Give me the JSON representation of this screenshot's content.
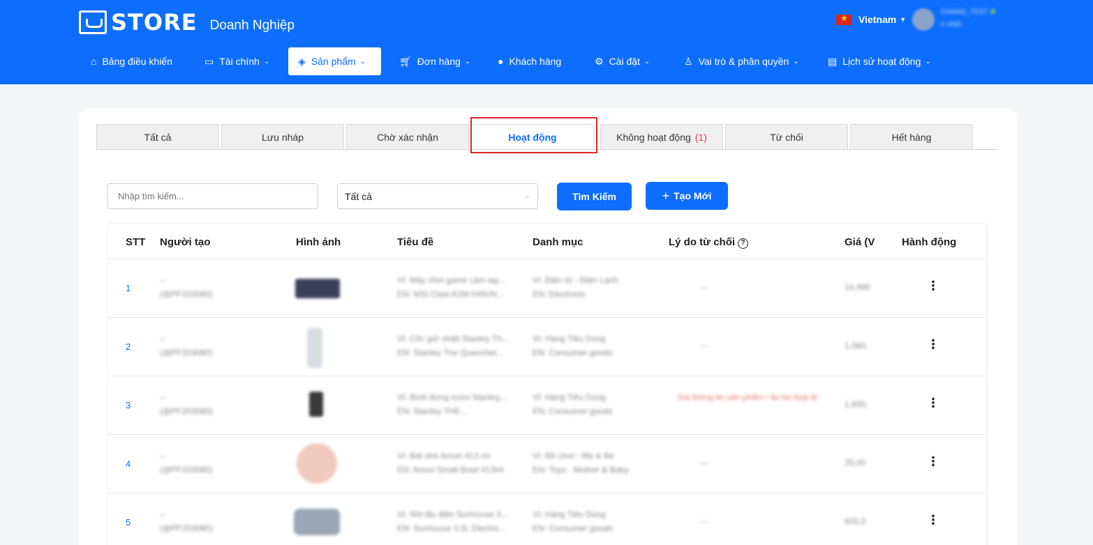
{
  "header": {
    "logo_text": "STORE",
    "subtitle": "Doanh Nghiệp",
    "language": "Vietnam",
    "user_name": "CHANG_TEST",
    "user_sub": "0 VND"
  },
  "nav": [
    {
      "label": "Bảng điều khiển",
      "icon": "home-icon"
    },
    {
      "label": "Tài chính",
      "icon": "wallet-icon"
    },
    {
      "label": "Sản phẩm",
      "icon": "layers-icon",
      "active": true
    },
    {
      "label": "Đơn hàng",
      "icon": "cart-icon"
    },
    {
      "label": "Khách hàng",
      "icon": "user-icon"
    },
    {
      "label": "Cài đặt",
      "icon": "gear-icon"
    },
    {
      "label": "Vai trò & phân quyền",
      "icon": "user-key-icon"
    },
    {
      "label": "Lịch sử hoạt động",
      "icon": "clipboard-icon"
    }
  ],
  "tabs": [
    {
      "label": "Tất cả"
    },
    {
      "label": "Lưu nháp"
    },
    {
      "label": "Chờ xác nhận"
    },
    {
      "label": "Hoạt động",
      "active": true
    },
    {
      "label": "Không hoạt động",
      "count": "(1)"
    },
    {
      "label": "Từ chối"
    },
    {
      "label": "Hết hàng"
    }
  ],
  "filters": {
    "search_placeholder": "Nhập tìm kiếm...",
    "select_value": "Tất cả",
    "search_button": "Tìm Kiếm",
    "create_button": "Tạo Mới"
  },
  "table": {
    "headers": {
      "stt": "STT",
      "creator": "Người tạo",
      "image": "Hình ảnh",
      "title": "Tiêu đề",
      "category": "Danh mục",
      "reason": "Lý do từ chối",
      "price": "Giá (V",
      "action": "Hành động"
    },
    "rows": [
      {
        "stt": "1",
        "creator": "--",
        "creator_id": "(@PF203080)",
        "title_vi": "VI: Máy chơi game cầm tay...",
        "title_en": "EN: MSI Claw A1M-049VN...",
        "cat_vi": "VI: Điện tử - Điện Lạnh",
        "cat_en": "EN: Electronic",
        "reason": "---",
        "price": "14,490"
      },
      {
        "stt": "2",
        "creator": "--",
        "creator_id": "(@PF203080)",
        "title_vi": "VI: Cốc giữ nhiệt Stanley Th...",
        "title_en": "EN: Stanley The Quencher...",
        "cat_vi": "VI: Hàng Tiêu Dùng",
        "cat_en": "EN: Consumer goods",
        "reason": "---",
        "price": "1,080,"
      },
      {
        "stt": "3",
        "creator": "--",
        "creator_id": "(@PF203080)",
        "title_vi": "VI: Bình đựng rượu Stanley...",
        "title_en": "EN: Stanley THE...",
        "cat_vi": "VI: Hàng Tiêu Dùng",
        "cat_en": "EN: Consumer goods",
        "reason": "Sai thông tin sản phẩm / ảo bọ hợp lệ",
        "price": "1,600,"
      },
      {
        "stt": "4",
        "creator": "--",
        "creator_id": "(@PF203080)",
        "title_vi": "VI: Bát nhỏ Amori 413 ml",
        "title_en": "EN: Amori Small Bowl 413ml",
        "cat_vi": "VI: Đồ chơi - Mẹ & Bé",
        "cat_en": "EN: Toys - Mother & Baby",
        "reason": "---",
        "price": "25,00"
      },
      {
        "stt": "5",
        "creator": "--",
        "creator_id": "(@PF203080)",
        "title_vi": "VI: Nồi lẩu điện Sunhouse 3...",
        "title_en": "EN: Sunhouse 3.5L Electric...",
        "cat_vi": "VI: Hàng Tiêu Dùng",
        "cat_en": "EN: Consumer goods",
        "reason": "---",
        "price": "605,0"
      }
    ]
  }
}
